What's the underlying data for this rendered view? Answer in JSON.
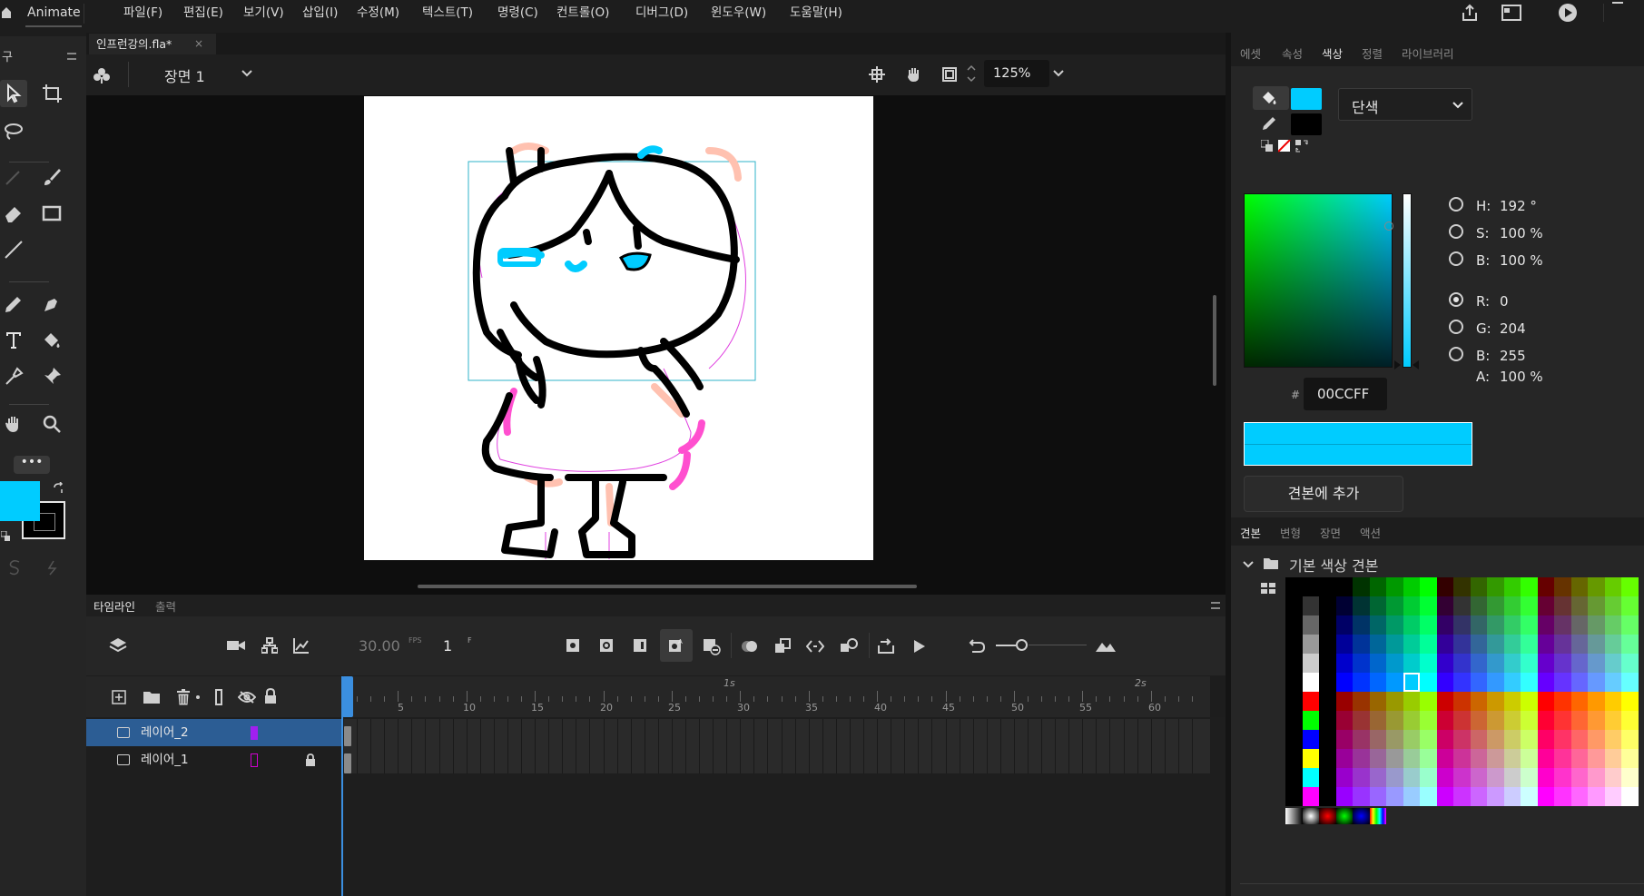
{
  "app": {
    "name": "Animate"
  },
  "menu": [
    {
      "label": "파일(F)"
    },
    {
      "label": "편집(E)"
    },
    {
      "label": "보기(V)"
    },
    {
      "label": "삽입(I)"
    },
    {
      "label": "수정(M)"
    },
    {
      "label": "텍스트(T)"
    },
    {
      "label": "명령(C)"
    },
    {
      "label": "컨트롤(O)"
    },
    {
      "label": "디버그(D)"
    },
    {
      "label": "윈도우(W)"
    },
    {
      "label": "도움말(H)"
    }
  ],
  "tools_panel": {
    "title": "구"
  },
  "document": {
    "tab_title": "인프런강의.fla*",
    "scene": "장면 1",
    "zoom": "125%"
  },
  "timeline": {
    "tabs": [
      "타임라인",
      "출력"
    ],
    "fps": "30.00",
    "fps_unit": "FPS",
    "current_frame": "1",
    "frame_unit": "F",
    "ruler_numbers": [
      "5",
      "10",
      "15",
      "20",
      "25",
      "30",
      "35",
      "40",
      "45",
      "50",
      "55",
      "60"
    ],
    "ruler_seconds": [
      "1s",
      "2s"
    ],
    "layers": [
      {
        "name": "레이어_2",
        "color": "#a020f0",
        "selected": true,
        "locked": false
      },
      {
        "name": "레이어_1",
        "color": "#d000d0",
        "selected": false,
        "locked": true
      }
    ]
  },
  "properties": {
    "tabs": [
      "에셋",
      "속성",
      "색상",
      "정렬",
      "라이브러리"
    ],
    "active_tab": "색상",
    "fill_color": "#00CCFF",
    "stroke_color": "#000000",
    "fill_type": "단색",
    "hsb": {
      "h_label": "H:",
      "h": "192 °",
      "s_label": "S:",
      "s": "100 %",
      "b_label": "B:",
      "b": "100 %"
    },
    "rgb": {
      "r_label": "R:",
      "r": "0",
      "g_label": "G:",
      "g": "204",
      "b_label": "B:",
      "b": "255"
    },
    "alpha_label": "A:",
    "alpha": "100 %",
    "hex_prefix": "#",
    "hex": "00CCFF",
    "add_swatch_label": "견본에 추가"
  },
  "swatches_panel": {
    "tabs": [
      "견본",
      "변형",
      "장면",
      "액션"
    ],
    "folder_label": "기본 색상 견본"
  },
  "colors": {
    "accent": "#00CCFF",
    "selection": "#2c5d94",
    "playhead": "#3b8fe0"
  }
}
